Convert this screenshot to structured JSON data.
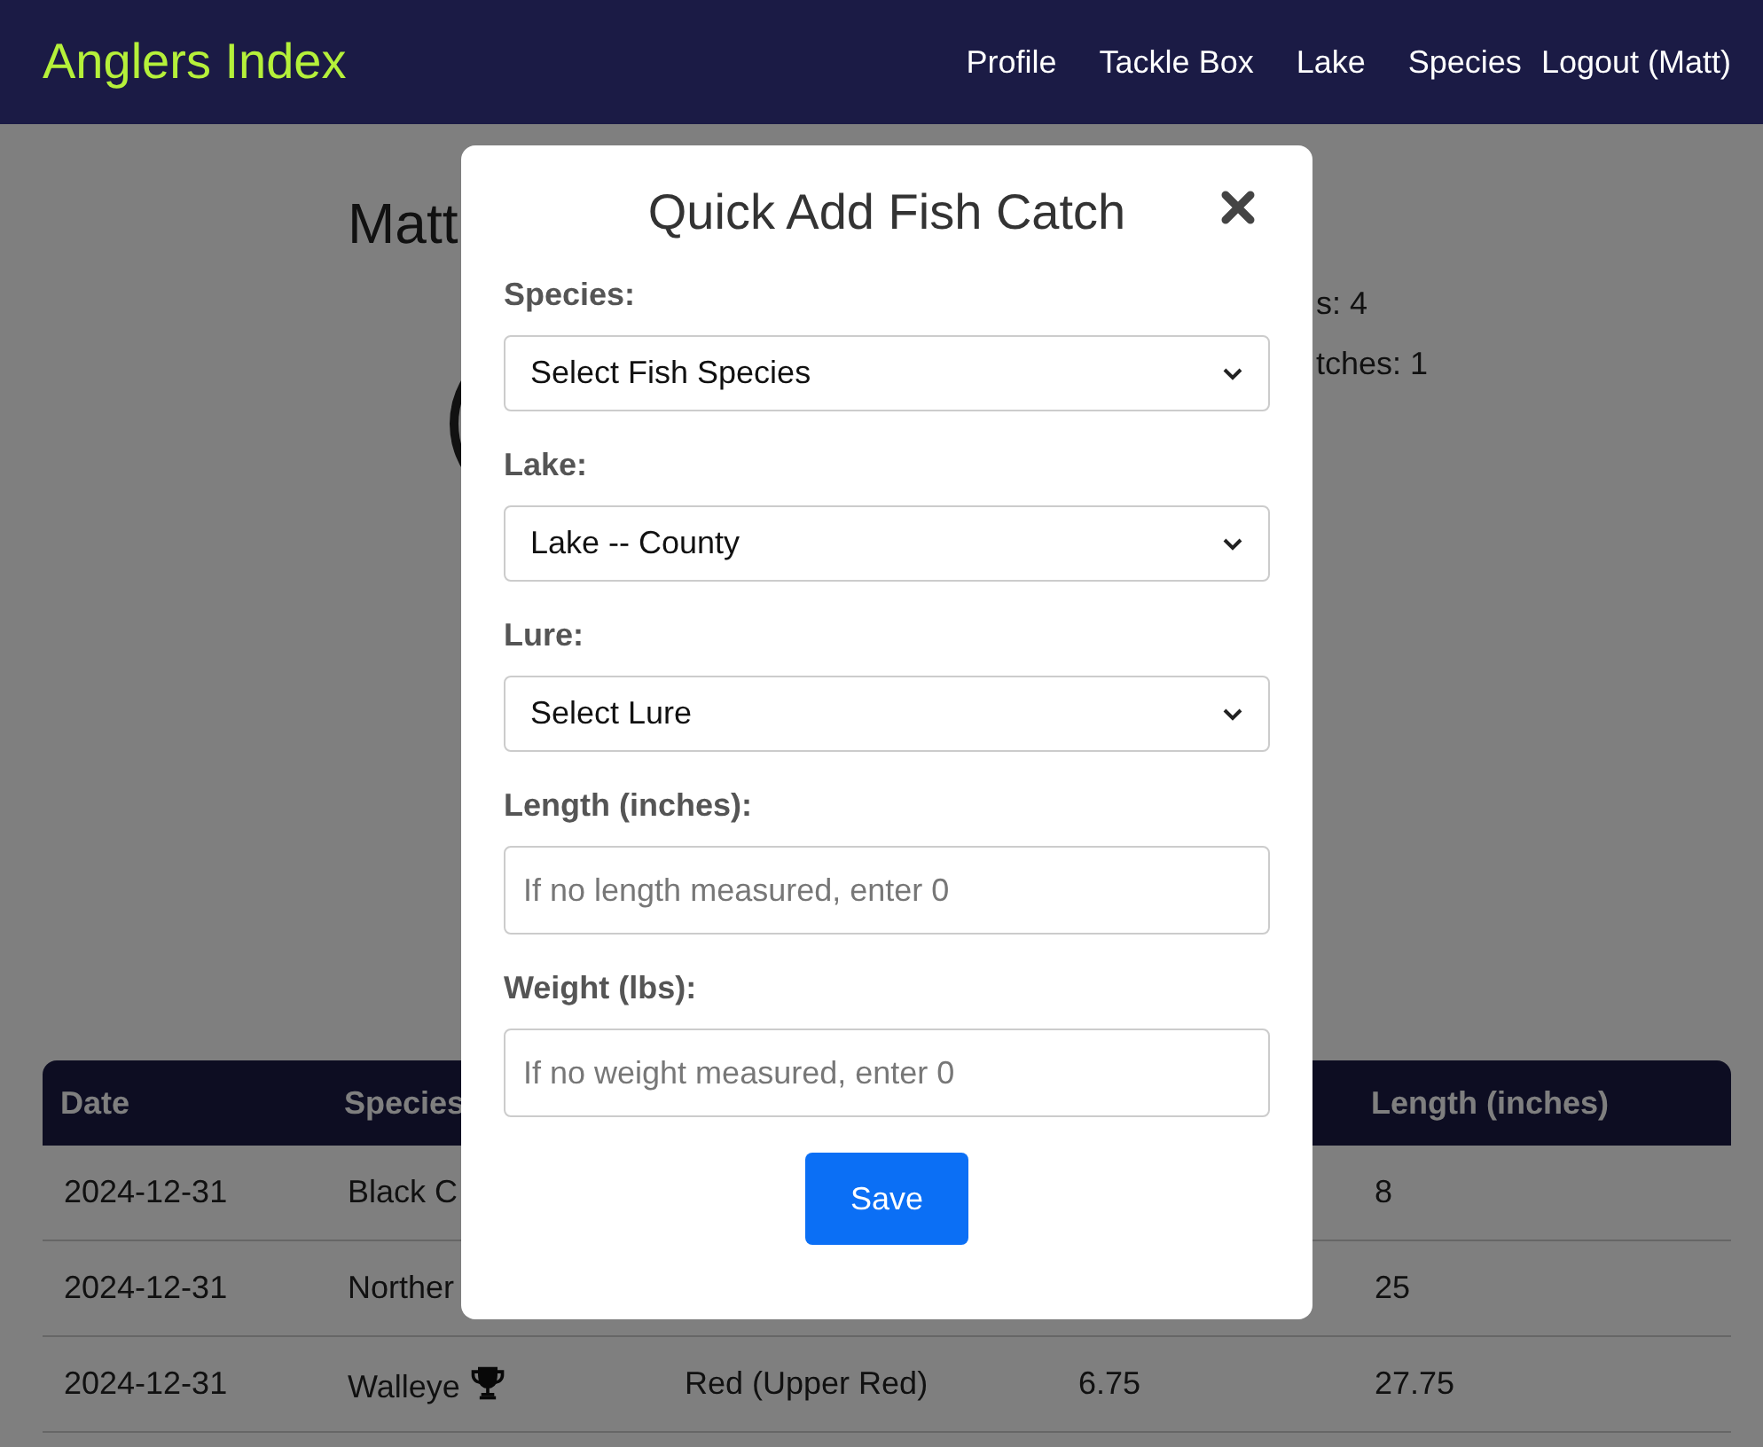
{
  "navbar": {
    "brand": "Anglers Index",
    "links": [
      "Profile",
      "Tackle Box",
      "Lake",
      "Species",
      "Logout (Matt)"
    ]
  },
  "profile": {
    "name": "Matt",
    "stats": [
      "s: 4",
      "tches: 1"
    ]
  },
  "table": {
    "header": {
      "date": "Date",
      "species": "Species",
      "length": "Length (inches)"
    },
    "rows": [
      {
        "date": "2024-12-31",
        "species": "Black C",
        "trophy": false,
        "length": "8"
      },
      {
        "date": "2024-12-31",
        "species": "Norther",
        "trophy": false,
        "length": "25"
      },
      {
        "date": "2024-12-31",
        "species": "Walleye",
        "trophy": true,
        "column_3": "Red (Upper Red)",
        "column_4": "6.75",
        "length": "27.75"
      }
    ]
  },
  "modal": {
    "title": "Quick Add Fish Catch",
    "fields": [
      {
        "label": "Species:",
        "kind": "select",
        "value": "Select Fish Species"
      },
      {
        "label": "Lake:",
        "kind": "select",
        "value": "Lake -- County"
      },
      {
        "label": "Lure:",
        "kind": "select",
        "value": "Select Lure"
      },
      {
        "label": "Length (inches):",
        "kind": "input",
        "placeholder": "If no length measured, enter 0"
      },
      {
        "label": "Weight (lbs):",
        "kind": "input",
        "placeholder": "If no weight measured, enter 0"
      }
    ],
    "button": "Save"
  }
}
